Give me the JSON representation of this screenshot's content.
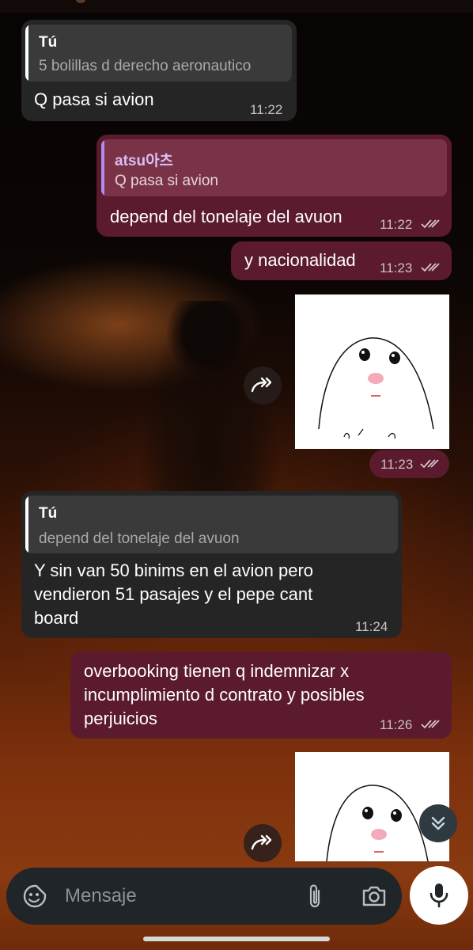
{
  "messages": [
    {
      "id": "m1",
      "reply_name": "Tú",
      "reply_text": "5 bolillas d derecho aeronautico",
      "text": "Q pasa si avion",
      "time": "11:22"
    },
    {
      "id": "m2",
      "reply_name": "atsu아츠",
      "reply_text": "Q pasa si avion",
      "text": "depend del tonelaje del avuon",
      "time": "11:22"
    },
    {
      "id": "m3",
      "text": "y nacionalidad",
      "time": "11:23"
    },
    {
      "id": "m4",
      "time": "11:23"
    },
    {
      "id": "m5",
      "reply_name": "Tú",
      "reply_text": "depend del tonelaje del avuon",
      "text_lines": [
        "Y sin van 50 binims en el avion pero",
        "vendieron 51 pasajes y el pepe cant",
        "board"
      ],
      "time": "11:24"
    },
    {
      "id": "m6",
      "text_lines": [
        "overbooking tienen q indemnizar x",
        "incumplimiento d contrato y posibles",
        "perjuicios"
      ],
      "time": "11:26"
    }
  ],
  "input": {
    "placeholder": "Mensaje"
  },
  "colors": {
    "incoming": "#252525",
    "outgoing": "#5b1a2e",
    "reply_accent_in": "#ffffff",
    "reply_accent_out": "#b48cf0"
  },
  "icons": [
    "sticker-icon",
    "attach-icon",
    "camera-icon",
    "mic-icon",
    "forward-icon",
    "double-check-icon",
    "chevron-double-down-icon"
  ]
}
